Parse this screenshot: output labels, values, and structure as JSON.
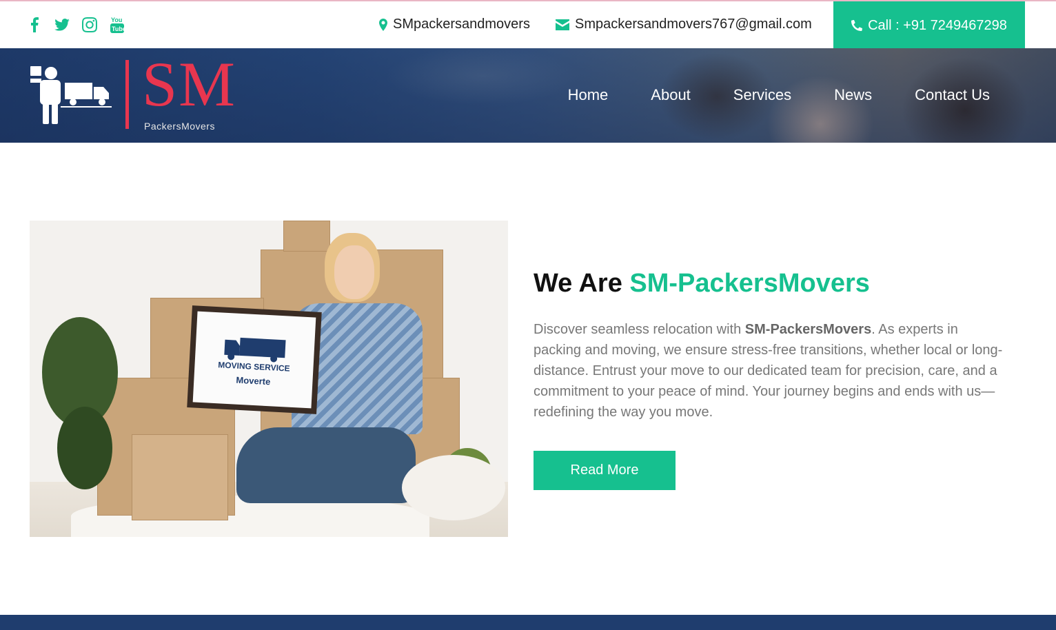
{
  "topbar": {
    "social_icons": [
      "facebook-icon",
      "twitter-icon",
      "instagram-icon",
      "youtube-icon"
    ],
    "location_label": "SMpackersandmovers",
    "email_label": "Smpackersandmovers767@gmail.com",
    "call_label": "Call : +91 7249467298"
  },
  "header": {
    "logo_text": "SM",
    "logo_tagline": "PackersMovers",
    "nav": [
      "Home",
      "About",
      "Services",
      "News",
      "Contact Us"
    ]
  },
  "about": {
    "title_prefix": "We Are ",
    "title_accent": "SM-PackersMovers",
    "desc_intro": "Discover seamless relocation with ",
    "desc_brand": "SM-PackersMovers",
    "desc_rest": ". As experts in packing and moving, we ensure stress-free transitions, whether local or long-distance. Entrust your move to our dedicated team for precision, care, and a commitment to your peace of mind. Your journey begins and ends with us—redefining the way you move.",
    "image_sign_line1": "MOVING SERVICE",
    "image_sign_line2": "Moverte",
    "read_more_label": "Read More"
  },
  "colors": {
    "accent": "#16c08f",
    "brand_red": "#e8364f",
    "navy": "#1f3d6e"
  }
}
